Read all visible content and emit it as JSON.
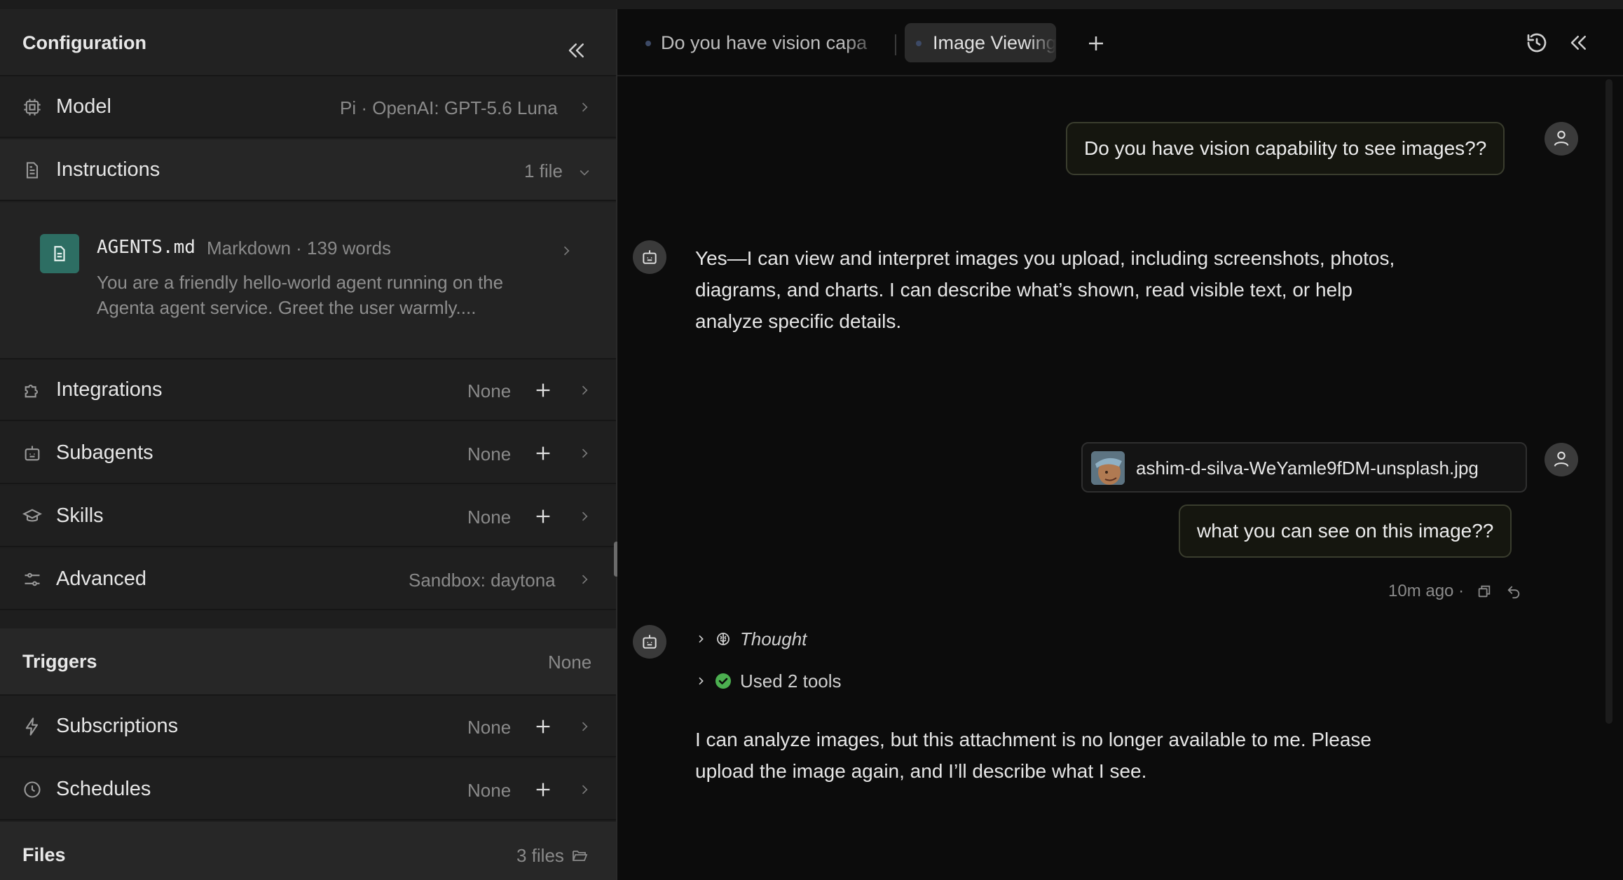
{
  "config": {
    "title": "Configuration",
    "model": {
      "label": "Model",
      "value": "Pi · OpenAI: GPT-5.6 Luna"
    },
    "instructions": {
      "label": "Instructions",
      "value": "1 file",
      "file": {
        "name": "AGENTS.md",
        "meta": "Markdown · 139 words",
        "desc_line1": "You are a friendly hello-world agent running on the",
        "desc_line2": "Agenta agent service. Greet the user warmly...."
      }
    },
    "integrations": {
      "label": "Integrations",
      "value": "None"
    },
    "subagents": {
      "label": "Subagents",
      "value": "None"
    },
    "skills": {
      "label": "Skills",
      "value": "None"
    },
    "advanced": {
      "label": "Advanced",
      "value": "Sandbox: daytona"
    },
    "triggers": {
      "label": "Triggers",
      "value": "None"
    },
    "subscriptions": {
      "label": "Subscriptions",
      "value": "None"
    },
    "schedules": {
      "label": "Schedules",
      "value": "None"
    },
    "files": {
      "label": "Files",
      "value": "3 files"
    }
  },
  "tabs": [
    {
      "label": "Do you have vision capa"
    },
    {
      "label": "Image Viewing"
    }
  ],
  "chat": {
    "msg1": "Do you have vision capability to see images??",
    "reply1": {
      "line1": "Yes—I can view and interpret images you upload, including screenshots, photos,",
      "line2": "diagrams, and charts. I can describe what’s shown, read visible text, or help",
      "line3": "analyze specific details."
    },
    "attachment": "ashim-d-silva-WeYamle9fDM-unsplash.jpg",
    "msg2": "what you can see on this image??",
    "msg2_meta": "10m ago ·",
    "thought_label": "Thought",
    "tools_label": "Used 2 tools",
    "reply2": {
      "line1": "I can analyze images, but this attachment is no longer available to me. Please",
      "line2": "upload the image again, and I’ll describe what I see."
    }
  },
  "colors": {
    "success": "#4caf50",
    "file_badge": "#2d6e63"
  }
}
